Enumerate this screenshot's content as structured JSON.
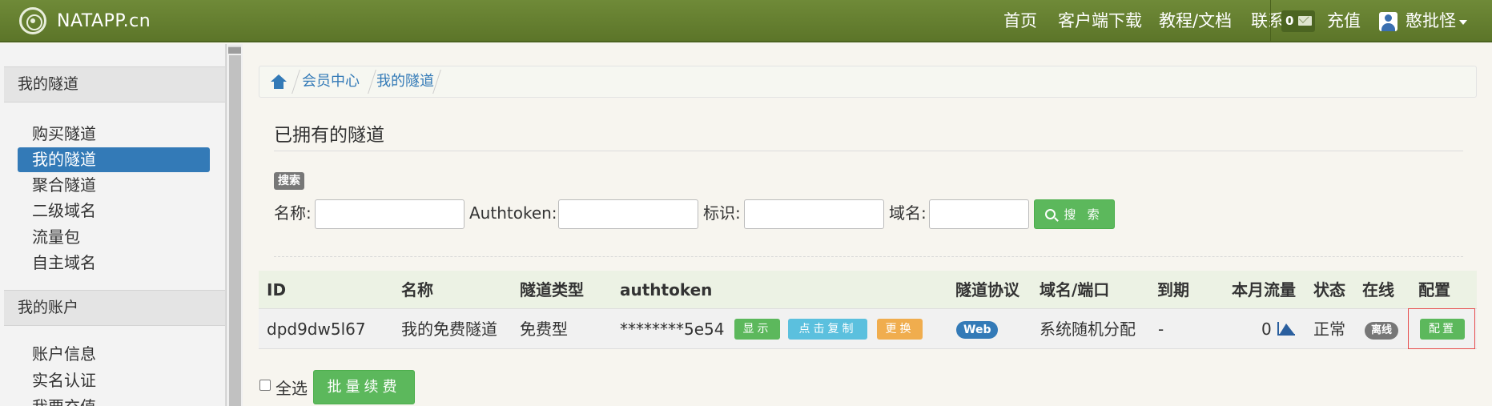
{
  "header": {
    "brand": "NATAPP.cn",
    "nav": [
      "首页",
      "客户端下载",
      "教程/文档",
      "联系"
    ],
    "mail_count": "0",
    "recharge": "充值",
    "username": "憨批怪"
  },
  "sidebar": {
    "section1": "我的隧道",
    "items1": [
      "购买隧道",
      "我的隧道",
      "聚合隧道",
      "二级域名",
      "流量包",
      "自主域名"
    ],
    "section2": "我的账户",
    "items2": [
      "账户信息",
      "实名认证",
      "我要充值"
    ]
  },
  "breadcrumb": [
    "会员中心",
    "我的隧道"
  ],
  "page_title": "已拥有的隧道",
  "search": {
    "badge": "搜索",
    "name_label": "名称:",
    "authtoken_label": "Authtoken:",
    "tag_label": "标识:",
    "domain_label": "域名:",
    "button": "搜 索"
  },
  "table": {
    "headers": [
      "ID",
      "名称",
      "隧道类型",
      "authtoken",
      "隧道协议",
      "域名/端口",
      "到期",
      "本月流量",
      "状态",
      "在线",
      "配置"
    ],
    "row": {
      "id": "dpd9dw5l67",
      "name": "我的免费隧道",
      "type": "免费型",
      "authtoken": "********5e54",
      "btn_show": "显示",
      "btn_copy": "点击复制",
      "btn_change": "更换",
      "protocol": "Web",
      "domain": "系统随机分配",
      "expire": "-",
      "traffic": "0",
      "status": "正常",
      "online": "离线",
      "config": "配置"
    }
  },
  "bottom": {
    "select_all": "全选",
    "batch_renew": "批量续费"
  },
  "colors": {
    "header": "#6a8534",
    "primary": "#337ab7",
    "success": "#5cb85c",
    "info": "#5bc0de",
    "warning": "#f0ad4e",
    "highlight": "#e74c4c"
  }
}
